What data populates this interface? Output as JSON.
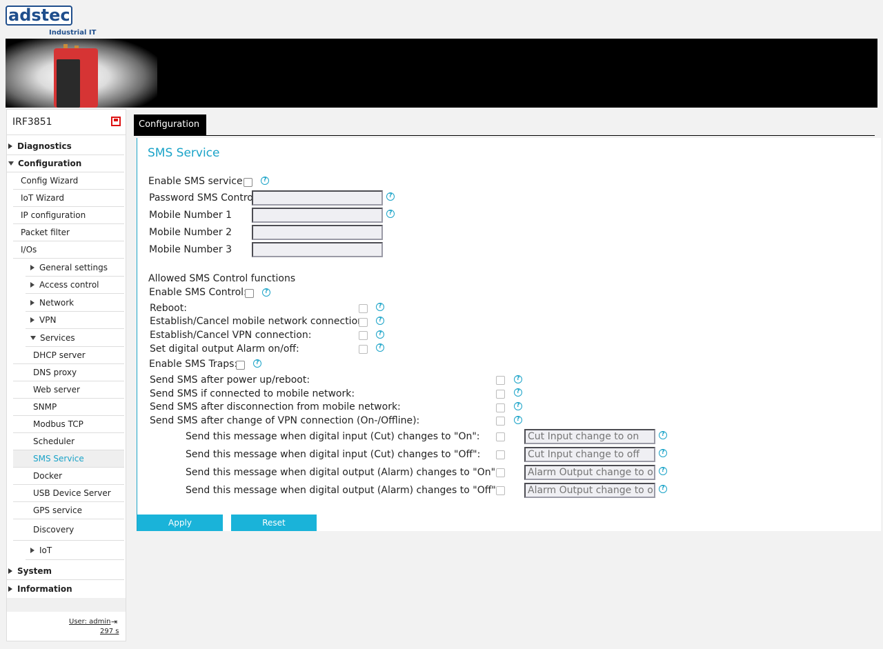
{
  "brand": {
    "logo": "adstec",
    "subtitle": "Industrial IT"
  },
  "device": {
    "name": "IRF3851"
  },
  "nav": {
    "diagnostics": "Diagnostics",
    "configuration": "Configuration",
    "config_wizard": "Config Wizard",
    "iot_wizard": "IoT Wizard",
    "ip_configuration": "IP configuration",
    "packet_filter": "Packet filter",
    "ios": "I/Os",
    "general_settings": "General settings",
    "access_control": "Access control",
    "network": "Network",
    "vpn": "VPN",
    "services": "Services",
    "dhcp_server": "DHCP server",
    "dns_proxy": "DNS proxy",
    "web_server": "Web server",
    "snmp": "SNMP",
    "modbus_tcp": "Modbus TCP",
    "scheduler": "Scheduler",
    "sms_service": "SMS Service",
    "docker": "Docker",
    "usb_device_server": "USB Device Server",
    "gps_service": "GPS service",
    "discovery": "Discovery",
    "iot": "IoT",
    "system": "System",
    "information": "Information"
  },
  "user": {
    "label": "User: admin",
    "session": "297 s"
  },
  "tab": {
    "label": "Configuration"
  },
  "page": {
    "title": "SMS Service",
    "enable_sms_service": "Enable SMS service:",
    "password_sms_control": "Password SMS Control",
    "mobile_1": "Mobile Number 1",
    "mobile_2": "Mobile Number 2",
    "mobile_3": "Mobile Number 3",
    "allowed_heading": "Allowed SMS Control functions",
    "enable_sms_control": "Enable SMS Control:",
    "reboot": "Reboot:",
    "mobile_conn": "Establish/Cancel mobile network connection:",
    "vpn_conn": "Establish/Cancel VPN connection:",
    "alarm": "Set digital output Alarm on/off:",
    "enable_sms_traps": "Enable SMS Traps:",
    "trap_power": "Send SMS after power up/reboot:",
    "trap_connected": "Send SMS if connected to mobile network:",
    "trap_disconnect": "Send SMS after disconnection from mobile network:",
    "trap_vpn": "Send SMS after change of VPN connection (On-/Offline):",
    "msg_cut_on": "Send this message when digital input (Cut) changes to \"On\":",
    "msg_cut_off": "Send this message when digital input (Cut) changes to \"Off\":",
    "msg_alarm_on": "Send this message when digital output (Alarm) changes to \"On\":",
    "msg_alarm_off": "Send this message when digital output (Alarm) changes to \"Off\":",
    "ph_cut_on": "Cut Input change to on",
    "ph_cut_off": "Cut Input change to off",
    "ph_alarm_on": "Alarm Output change to on",
    "ph_alarm_off": "Alarm Output change to off",
    "apply": "Apply",
    "reset": "Reset"
  }
}
